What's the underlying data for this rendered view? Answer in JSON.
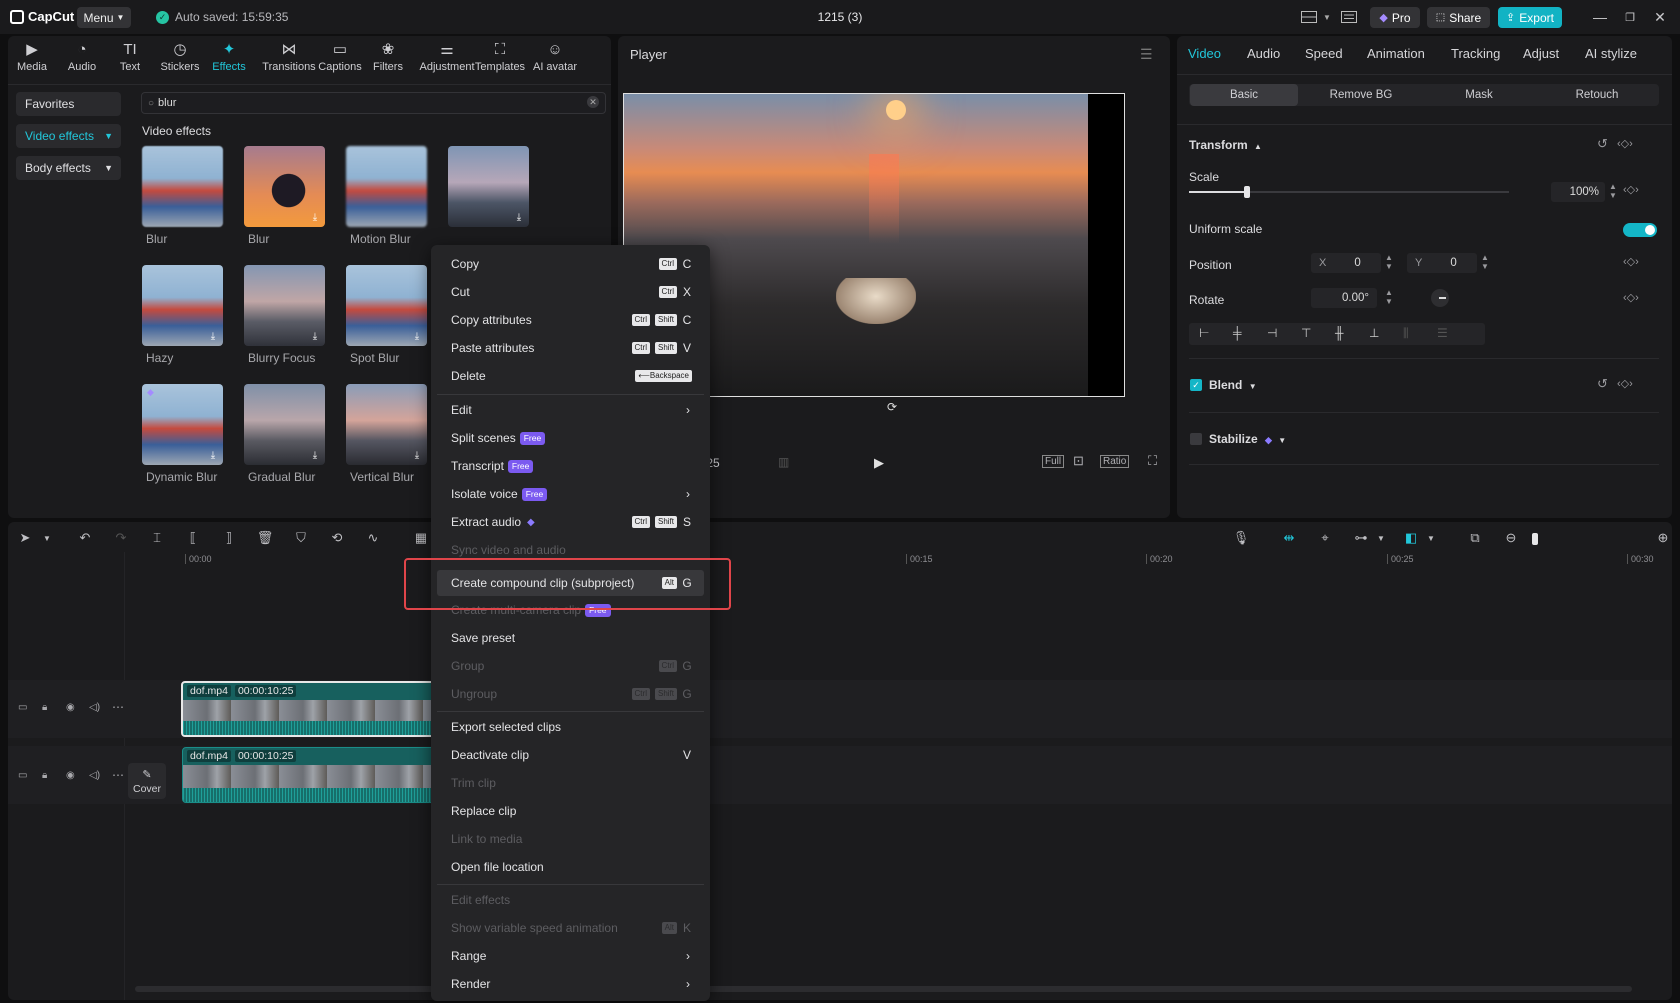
{
  "titlebar": {
    "app_name": "CapCut",
    "menu_label": "Menu",
    "autosave": "Auto saved: 15:59:35",
    "project_name": "1215 (3)",
    "pro_label": "Pro",
    "share_label": "Share",
    "export_label": "Export"
  },
  "left_toolbar": [
    {
      "label": "Media",
      "icon": "media-icon"
    },
    {
      "label": "Audio",
      "icon": "audio-icon"
    },
    {
      "label": "Text",
      "icon": "text-icon"
    },
    {
      "label": "Stickers",
      "icon": "stickers-icon"
    },
    {
      "label": "Effects",
      "icon": "effects-icon",
      "active": true
    },
    {
      "label": "Transitions",
      "icon": "transitions-icon"
    },
    {
      "label": "Captions",
      "icon": "captions-icon"
    },
    {
      "label": "Filters",
      "icon": "filters-icon"
    },
    {
      "label": "Adjustment",
      "icon": "adjustment-icon"
    },
    {
      "label": "Templates",
      "icon": "templates-icon"
    },
    {
      "label": "AI avatar",
      "icon": "ai-avatar-icon"
    }
  ],
  "categories": {
    "favorites": "Favorites",
    "video_effects": "Video effects",
    "body_effects": "Body effects"
  },
  "search": {
    "value": "blur"
  },
  "effects_section_title": "Video effects",
  "effects": [
    {
      "label": "Blur",
      "download": false
    },
    {
      "label": "Blur",
      "download": true
    },
    {
      "label": "Motion Blur",
      "download": false
    },
    {
      "label": "",
      "download": true
    },
    {
      "label": "Hazy",
      "download": true
    },
    {
      "label": "Blurry Focus",
      "download": true
    },
    {
      "label": "Spot Blur",
      "download": true
    },
    {
      "label": "Dynamic Blur",
      "download": true
    },
    {
      "label": "Gradual Blur",
      "download": true
    },
    {
      "label": "Vertical Blur",
      "download": true
    }
  ],
  "player": {
    "title": "Player",
    "current_time": "0:00:10:25",
    "full_label": "Full",
    "ratio_label": "Ratio"
  },
  "right_panel": {
    "tabs": [
      "Video",
      "Audio",
      "Speed",
      "Animation",
      "Tracking",
      "Adjust",
      "AI stylize"
    ],
    "subtabs": [
      "Basic",
      "Remove BG",
      "Mask",
      "Retouch"
    ],
    "transform_label": "Transform",
    "scale_label": "Scale",
    "scale_value": "100%",
    "scale_fraction": 0.18,
    "uniform_scale_label": "Uniform scale",
    "position_label": "Position",
    "pos_x_label": "X",
    "pos_x": "0",
    "pos_y_label": "Y",
    "pos_y": "0",
    "rotate_label": "Rotate",
    "rotate_value": "0.00°",
    "blend_label": "Blend",
    "stabilize_label": "Stabilize"
  },
  "timeline": {
    "ruler": [
      "00:00",
      "00:15",
      "00:20",
      "00:25",
      "00:30"
    ],
    "clip_name": "dof.mp4",
    "clip_duration": "00:00:10:25",
    "cover_label": "Cover"
  },
  "context_menu": {
    "copy": "Copy",
    "cut": "Cut",
    "copy_attributes": "Copy attributes",
    "paste_attributes": "Paste attributes",
    "delete": "Delete",
    "edit": "Edit",
    "split_scenes": "Split scenes",
    "transcript": "Transcript",
    "isolate_voice": "Isolate voice",
    "extract_audio": "Extract audio",
    "sync_video_audio": "Sync video and audio",
    "create_compound": "Create compound clip (subproject)",
    "create_multicam": "Create multi-camera clip",
    "save_preset": "Save preset",
    "group": "Group",
    "ungroup": "Ungroup",
    "export_selected": "Export selected clips",
    "deactivate_clip": "Deactivate clip",
    "trim_clip": "Trim clip",
    "replace_clip": "Replace clip",
    "link_to_media": "Link to media",
    "open_file_location": "Open file location",
    "edit_effects": "Edit effects",
    "show_variable_speed": "Show variable speed animation",
    "range": "Range",
    "render": "Render",
    "free_badge": "Free",
    "keys": {
      "ctrl": "Ctrl",
      "shift": "Shift",
      "alt": "Alt",
      "backspace": "⟵Backspace",
      "c": "C",
      "x": "X",
      "v": "V",
      "s": "S",
      "g": "G",
      "k": "K"
    }
  }
}
